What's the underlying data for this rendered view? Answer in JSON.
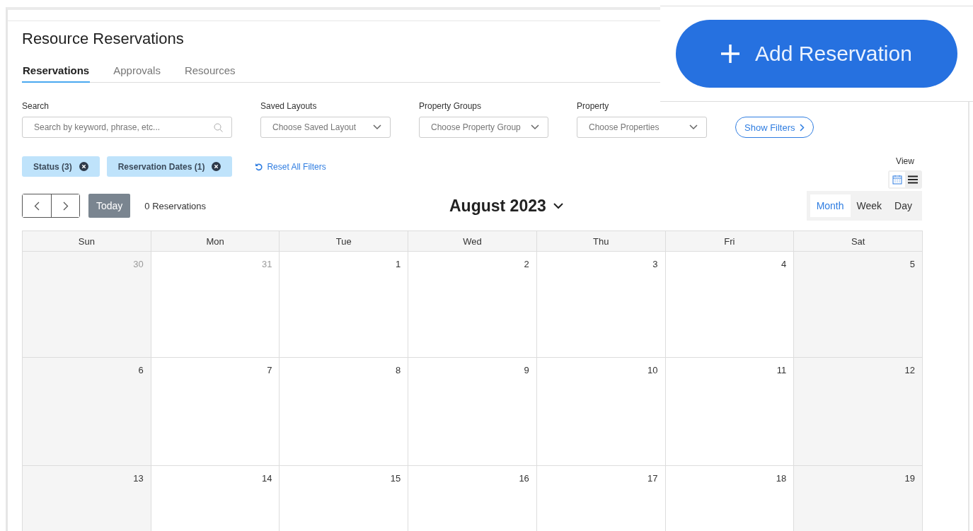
{
  "title": "Resource Reservations",
  "tabs": [
    {
      "label": "Reservations",
      "selected": true
    },
    {
      "label": "Approvals",
      "selected": false
    },
    {
      "label": "Resources",
      "selected": false
    }
  ],
  "filters": [
    {
      "kind": "search",
      "label": "Search",
      "placeholder": "Search by keyword, phrase, etc..."
    },
    {
      "kind": "select",
      "label": "Saved Layouts",
      "placeholder": "Choose Saved Layout"
    },
    {
      "kind": "select",
      "label": "Property Groups",
      "placeholder": "Choose Property Group"
    },
    {
      "kind": "select",
      "label": "Property",
      "placeholder": "Choose Properties"
    }
  ],
  "show_filters": "Show Filters",
  "chips": [
    "Status (3)",
    "Reservation Dates (1)"
  ],
  "reset": "Reset All Filters",
  "view": {
    "label": "View",
    "modes": [
      {
        "kind": "calendar",
        "selected": true
      },
      {
        "kind": "list",
        "selected": false
      }
    ]
  },
  "today": "Today",
  "count": "0 Reservations",
  "month": "August 2023",
  "ranges": [
    {
      "label": "Month",
      "selected": true
    },
    {
      "label": "Week",
      "selected": false
    },
    {
      "label": "Day",
      "selected": false
    }
  ],
  "weekdays": [
    "Sun",
    "Mon",
    "Tue",
    "Wed",
    "Thu",
    "Fri",
    "Sat"
  ],
  "weeks": [
    [
      {
        "day": "30",
        "outside": true
      },
      {
        "day": "31",
        "outside": true
      },
      {
        "day": "1",
        "outside": false
      },
      {
        "day": "2",
        "outside": false
      },
      {
        "day": "3",
        "outside": false
      },
      {
        "day": "4",
        "outside": false
      },
      {
        "day": "5",
        "outside": false
      }
    ],
    [
      {
        "day": "6",
        "outside": false
      },
      {
        "day": "7",
        "outside": false
      },
      {
        "day": "8",
        "outside": false
      },
      {
        "day": "9",
        "outside": false
      },
      {
        "day": "10",
        "outside": false
      },
      {
        "day": "11",
        "outside": false
      },
      {
        "day": "12",
        "outside": false
      }
    ],
    [
      {
        "day": "13",
        "outside": false
      },
      {
        "day": "14",
        "outside": false
      },
      {
        "day": "15",
        "outside": false
      },
      {
        "day": "16",
        "outside": false
      },
      {
        "day": "17",
        "outside": false
      },
      {
        "day": "18",
        "outside": false
      },
      {
        "day": "19",
        "outside": false
      }
    ]
  ],
  "add_button": "Add Reservation"
}
